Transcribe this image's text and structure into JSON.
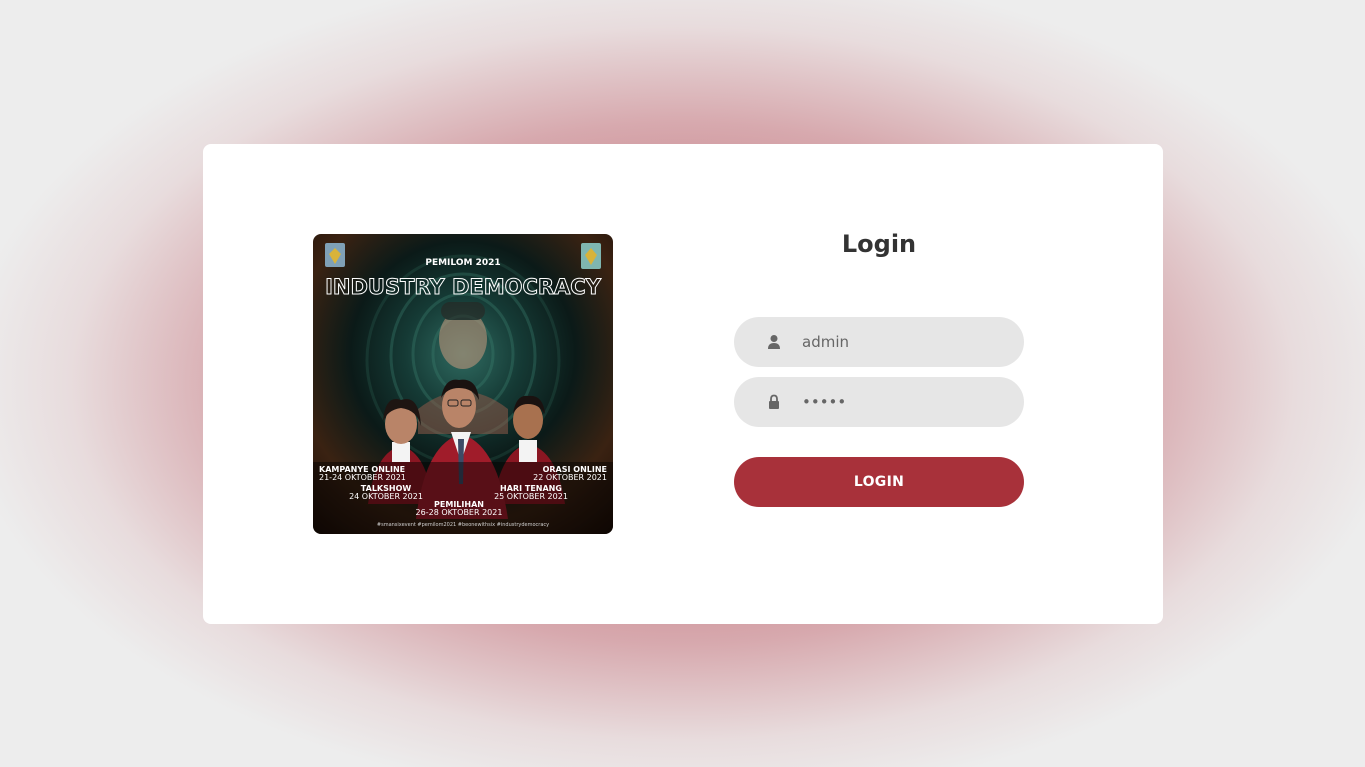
{
  "login": {
    "title": "Login",
    "username": {
      "value": "admin",
      "icon": "user-icon"
    },
    "password": {
      "value": "•••••",
      "icon": "lock-icon"
    },
    "button_label": "LOGIN"
  },
  "poster": {
    "subtitle": "PEMILOM 2021",
    "title": "INDUSTRY DEMOCRACY",
    "events": {
      "kampanye": {
        "name": "KAMPANYE ONLINE",
        "date": "21-24 OKTOBER 2021"
      },
      "orasi": {
        "name": "ORASI ONLINE",
        "date": "22 OKTOBER 2021"
      },
      "talkshow": {
        "name": "TALKSHOW",
        "date": "24 OKTOBER 2021"
      },
      "hari_tenang": {
        "name": "HARI TENANG",
        "date": "25 OKTOBER 2021"
      },
      "pemilihan": {
        "name": "PEMILIHAN",
        "date": "26-28 OKTOBER 2021"
      }
    },
    "hashtags": "#smansixevent  #pemilom2021  #beonewithsix  #industrydemocracy"
  },
  "colors": {
    "accent": "#a8313a",
    "field_bg": "#e6e6e6",
    "background_center": "#b85f68",
    "background_edge": "#ededed"
  }
}
